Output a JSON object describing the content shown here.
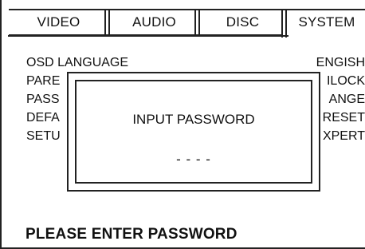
{
  "tabs": [
    {
      "label": "VIDEO"
    },
    {
      "label": "AUDIO"
    },
    {
      "label": "DISC"
    },
    {
      "label": "SYSTEM"
    }
  ],
  "active_tab": "SYSTEM",
  "menu_rows": [
    {
      "label": "OSD LANGUAGE",
      "value": "ENGISH"
    },
    {
      "label": "PARE",
      "value": "ILOCK"
    },
    {
      "label": "PASS",
      "value": "ANGE"
    },
    {
      "label": "DEFA",
      "value": "RESET"
    },
    {
      "label": "SETU",
      "value": "XPERT"
    }
  ],
  "dialog": {
    "title": "INPUT PASSWORD",
    "password_mask": "- - - -"
  },
  "status_text": "PLEASE ENTER PASSWORD"
}
